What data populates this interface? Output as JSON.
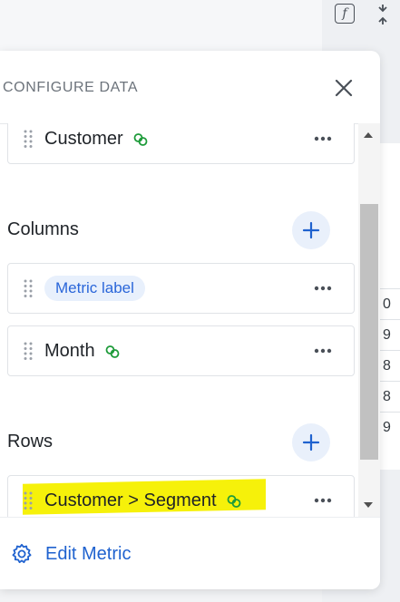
{
  "background": {
    "grid_values": [
      "0",
      "9",
      "8",
      "8",
      "9"
    ]
  },
  "panel": {
    "title": "CONFIGURE DATA",
    "top_field": {
      "label": "Customer",
      "linked": true
    },
    "columns": {
      "heading": "Columns",
      "fields": [
        {
          "label": "Metric label",
          "type": "pill"
        },
        {
          "label": "Month",
          "linked": true
        }
      ]
    },
    "rows": {
      "heading": "Rows",
      "fields": [
        {
          "label": "Customer > Segment",
          "linked": true,
          "highlighted": true
        }
      ]
    },
    "footer": {
      "edit_label": "Edit Metric"
    }
  },
  "colors": {
    "accent": "#1f62cf",
    "link_icon": "#1e9b3a",
    "pill_bg": "#e8f0fc",
    "highlight": "#f6f10a"
  },
  "icons": {
    "top_bar": [
      "function-icon",
      "collapse-icon"
    ],
    "header": "close-icon",
    "footer": "gear-icon"
  }
}
